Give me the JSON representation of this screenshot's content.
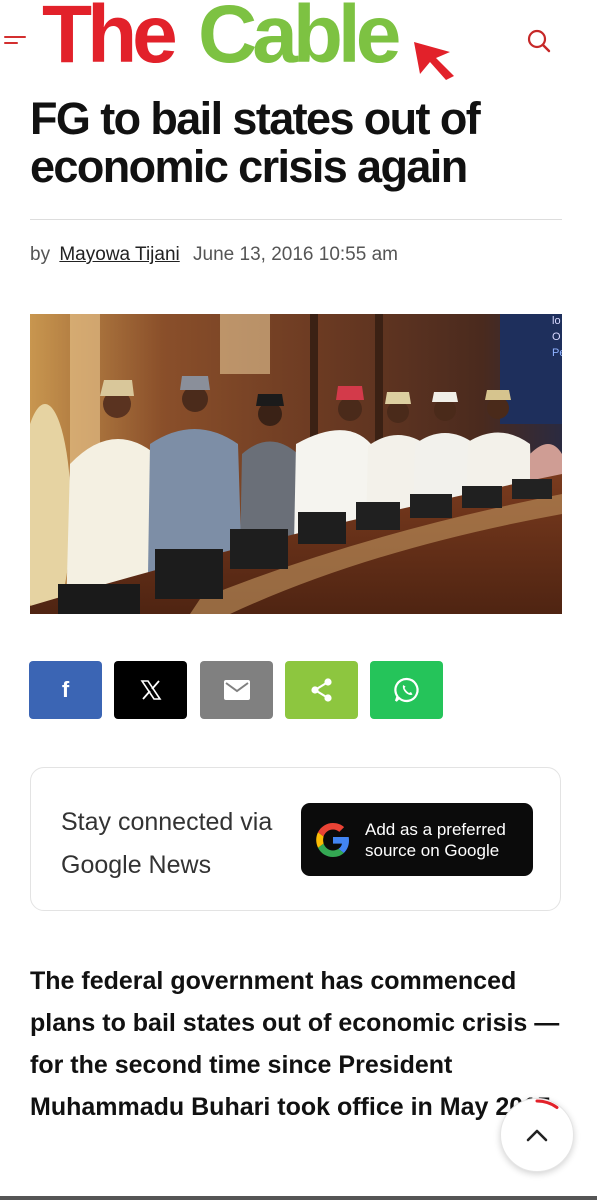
{
  "header": {
    "logo_part1": "The",
    "logo_part2": "Cable",
    "menu_icon": "hamburger-icon",
    "search_icon": "search-icon",
    "brand_red": "#e2212a",
    "brand_green": "#7dc242"
  },
  "article": {
    "title": "FG to bail states out of economic crisis again",
    "byline_prefix": "by",
    "author": "Mayowa Tijani",
    "date": "June 13, 2016 10:55 am",
    "lead": "The federal government has commenced plans to bail states out of economic crisis — for the second time since President Muhammadu Buhari took office in May 2015."
  },
  "share": [
    {
      "network": "facebook",
      "icon": "facebook-icon",
      "glyph": "f",
      "color": "#3b65b4"
    },
    {
      "network": "x",
      "icon": "x-icon",
      "glyph": "𝕏",
      "color": "#000000"
    },
    {
      "network": "email",
      "icon": "email-icon",
      "color": "#808080"
    },
    {
      "network": "share",
      "icon": "share-icon",
      "color": "#8dc63f"
    },
    {
      "network": "whatsapp",
      "icon": "whatsapp-icon",
      "color": "#25c45a"
    }
  ],
  "google_news": {
    "prompt": "Stay connected via Google News",
    "button_label": "Add as a preferred source on Google",
    "icon": "google-g-icon"
  },
  "scroll_top": {
    "icon": "chevron-up-icon",
    "reading_progress": 0.1
  }
}
